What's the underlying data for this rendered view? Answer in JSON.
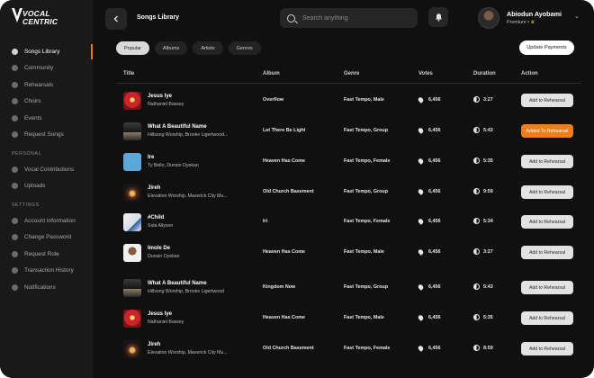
{
  "brand": {
    "logo_text_line1": "VOCAL",
    "logo_text_line2": "CENTRIC"
  },
  "sidebar": {
    "items": [
      {
        "label": "Songs Library",
        "icon": "music-icon",
        "active": true
      },
      {
        "label": "Community",
        "icon": "community-icon"
      },
      {
        "label": "Rehearsals",
        "icon": "microphone-icon"
      },
      {
        "label": "Choirs",
        "icon": "group-icon"
      },
      {
        "label": "Events",
        "icon": "calendar-icon"
      },
      {
        "label": "Request Songs",
        "icon": "request-icon"
      }
    ],
    "personal_label": "PERSONAL",
    "personal_items": [
      {
        "label": "Vocal Contributions",
        "icon": "vocal-icon"
      },
      {
        "label": "Uploads",
        "icon": "upload-icon"
      }
    ],
    "settings_label": "SETTINGS",
    "settings_items": [
      {
        "label": "Account Information",
        "icon": "user-icon"
      },
      {
        "label": "Change Password",
        "icon": "lock-icon"
      },
      {
        "label": "Request Role",
        "icon": "role-icon"
      },
      {
        "label": "Transaction History",
        "icon": "history-icon"
      },
      {
        "label": "Notifications",
        "icon": "notification-icon"
      }
    ]
  },
  "header": {
    "title": "Songs Library",
    "search_placeholder": "Search anything",
    "user_name": "Abiodun Ayobami",
    "user_plan": "Premium •",
    "crown": "♛"
  },
  "filters": {
    "chips": [
      "Popular",
      "Albums",
      "Artists",
      "Genres"
    ],
    "active": "Popular",
    "update_label": "Update Payments"
  },
  "table": {
    "columns": {
      "title": "Title",
      "album": "Album",
      "genre": "Genre",
      "votes": "Votes",
      "duration": "Duration",
      "action": "Action"
    },
    "rows": [
      {
        "title": "Jesus Iye",
        "artist": "Nathaniel Bassey",
        "album": "Overflow",
        "genre": "Fast Tempo, Male",
        "votes": "6,456",
        "duration": "3:27",
        "action": "Add to Rehearsal",
        "added": false,
        "thumb": "t-red"
      },
      {
        "title": "What A Beautiful Name",
        "artist": "Hillsong Worship, Brooke Ligertwood...",
        "album": "Let There Be Light",
        "genre": "Fast Tempo, Group",
        "votes": "6,456",
        "duration": "5:43",
        "action": "Added To Rehearsal",
        "added": true,
        "thumb": "t-dark"
      },
      {
        "title": "Ire",
        "artist": "Ty Bello, Dunsin Oyekan",
        "album": "Heaven Has Come",
        "genre": "Fast Tempo, Female",
        "votes": "6,456",
        "duration": "5:35",
        "action": "Add to Rehearsal",
        "added": false,
        "thumb": "t-blue"
      },
      {
        "title": "Jireh",
        "artist": "Elevation Worship, Maverick City Mu...",
        "album": "Old Church Basement",
        "genre": "Fast Tempo, Group",
        "votes": "6,456",
        "duration": "9:59",
        "action": "Add to Rehearsal",
        "added": false,
        "thumb": "t-fire"
      },
      {
        "title": "#Child",
        "artist": "Sola Allyson",
        "album": "Iri",
        "genre": "Fast Tempo, Female",
        "votes": "6,456",
        "duration": "5:34",
        "action": "Add to Rehearsal",
        "added": false,
        "thumb": "t-white"
      },
      {
        "title": "Imole De",
        "artist": "Dunsin Oyekan",
        "album": "Heaven Has Come",
        "genre": "Fast Tempo, Male",
        "votes": "6,456",
        "duration": "3:27",
        "action": "Add to Rehearsal",
        "added": false,
        "thumb": "t-face"
      },
      {
        "title": "What A Beautiful Name",
        "artist": "Hillsong Worship, Brooke Ligertwood",
        "album": "Kingdom Now",
        "genre": "Fast Tempo, Group",
        "votes": "6,456",
        "duration": "5:43",
        "action": "Add to Rehearsal",
        "added": false,
        "thumb": "t-dark"
      },
      {
        "title": "Jesus Iye",
        "artist": "Nathaniel Bassey",
        "album": "Heaven Has Come",
        "genre": "Fast Tempo, Male",
        "votes": "6,456",
        "duration": "5:35",
        "action": "Add to Rehearsal",
        "added": false,
        "thumb": "t-red"
      },
      {
        "title": "Jireh",
        "artist": "Elevation Worship, Maverick City Mu...",
        "album": "Old Church Basement",
        "genre": "Fast Tempo, Female",
        "votes": "6,456",
        "duration": "8:59",
        "action": "Add to Rehearsal",
        "added": false,
        "thumb": "t-fire"
      }
    ]
  },
  "colors": {
    "accent": "#ef7d1a",
    "background": "#101010",
    "sidebar": "#191919"
  }
}
